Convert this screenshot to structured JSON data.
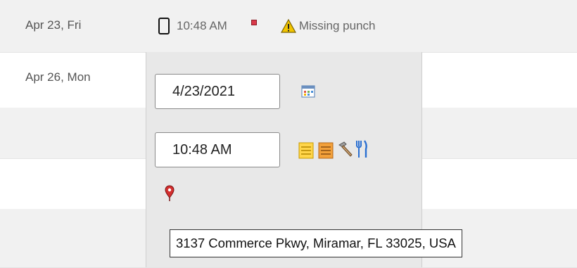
{
  "rows": [
    {
      "date": "Apr 23, Fri"
    },
    {
      "date": "Apr 26, Mon"
    },
    {
      "date": ""
    },
    {
      "date": ""
    },
    {
      "date": ""
    }
  ],
  "punch": {
    "device_icon": "mobile-phone-icon",
    "time": "10:48 AM",
    "flag_icon": "red-square-flag-icon",
    "warning_icon": "warning-triangle-icon",
    "status": "Missing punch"
  },
  "editor": {
    "date_value": "4/23/2021",
    "calendar_icon": "calendar-icon",
    "time_value": "10:48 AM",
    "note_icon": "yellow-note-icon",
    "note2_icon": "orange-note-icon",
    "work_icon": "hammer-icon",
    "meal_icon": "fork-knife-icon",
    "location_icon": "map-pin-icon",
    "address": "3137 Commerce Pkwy, Miramar, FL 33025, USA"
  },
  "colors": {
    "row_alt": "#f1f1f1",
    "popup_bg": "#e8e8e8",
    "flag": "#d9394a",
    "warning": "#f2c500",
    "pin": "#d32f2f"
  }
}
